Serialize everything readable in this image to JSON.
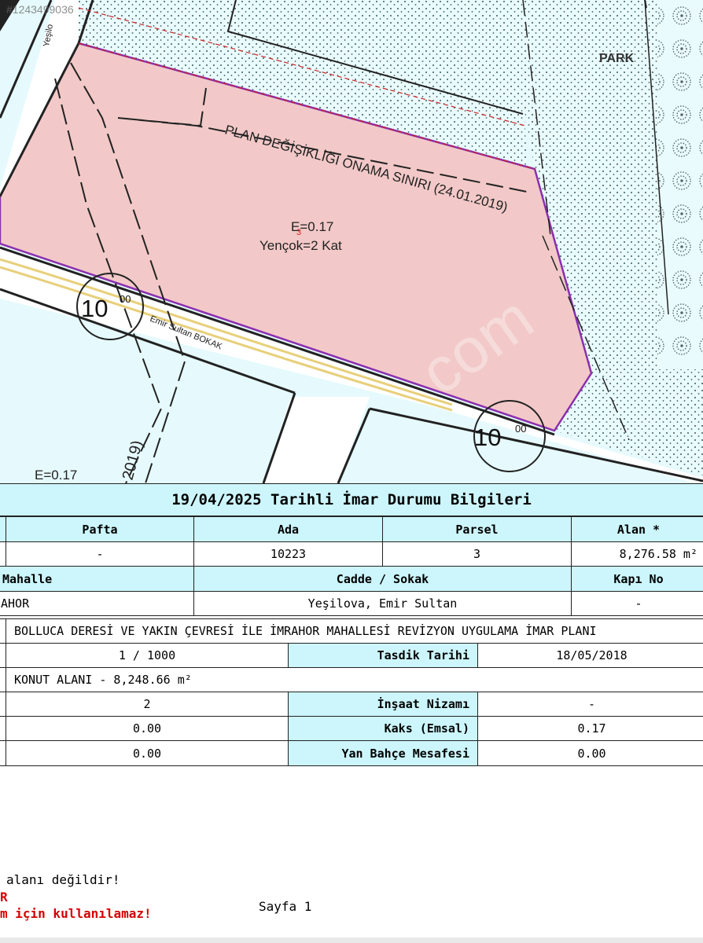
{
  "stamp_id": "#1243499036",
  "map": {
    "park_label": "PARK",
    "plan_boundary": "PLAN DEĞİŞİKLİĞİ ONAMA SINIRI (24.01.2019)",
    "emsal_parcel": "E=0.17",
    "emsal_marker": "3",
    "yencok": "Yençok=2 Kat",
    "road_width_1": "10",
    "road_width_1_sup": "00",
    "road_width_2": "10",
    "road_width_2_sup": "00",
    "street_name": "Emir Sultan BOKAK",
    "street_top": "Yeşilo",
    "emsal_bottom": "E=0.17",
    "rotated_date": "2019)",
    "watermark": "com"
  },
  "info": {
    "title": "19/04/2025 Tarihli İmar Durumu Bilgileri",
    "row1_headers": [
      "Pafta",
      "Ada",
      "Parsel",
      "Alan *"
    ],
    "row1_values": [
      "-",
      "10223",
      "3",
      "8,276.58 m²"
    ],
    "row2_headers": [
      "Mahalle",
      "Cadde / Sokak",
      "Kapı No"
    ],
    "row2_values": [
      "AHOR",
      "Yeşilova, Emir Sultan",
      "-"
    ],
    "plan_name": "BOLLUCA DERESİ VE YAKIN ÇEVRESİ İLE İMRAHOR MAHALLESİ REVİZYON UYGULAMA İMAR PLANI",
    "scale": "1 / 1000",
    "tasdik_label": "Tasdik Tarihi",
    "tasdik_value": "18/05/2018",
    "usage": "KONUT ALANI - 8,248.66 m²",
    "floors": "2",
    "insaat_label": "İnşaat Nizamı",
    "insaat_value": "-",
    "val_a": "0.00",
    "kaks_label": "Kaks (Emsal)",
    "kaks_value": "0.17",
    "val_b": "0.00",
    "yan_label": "Yan Bahçe Mesafesi",
    "yan_value": "0.00"
  },
  "footer": {
    "line1": "alanı değildir!",
    "line2": "R",
    "line3": "m için kullanılamaz!",
    "page": "Sayfa 1"
  }
}
